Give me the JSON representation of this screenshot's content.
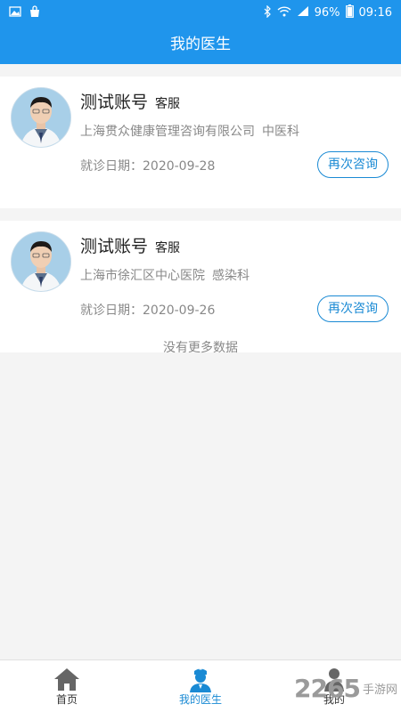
{
  "status_bar": {
    "battery": "96%",
    "time": "09:16",
    "icons": [
      "image-icon",
      "bag-icon",
      "bluetooth-icon",
      "wifi-icon",
      "signal-icon",
      "battery-icon"
    ]
  },
  "header": {
    "title": "我的医生"
  },
  "doctors": [
    {
      "name": "测试账号",
      "tag": "客服",
      "org": "上海贯众健康管理咨询有限公司",
      "dept": "中医科",
      "visit_date": "就诊日期：2020-09-28",
      "action_label": "再次咨询"
    },
    {
      "name": "测试账号",
      "tag": "客服",
      "org": "上海市徐汇区中心医院",
      "dept": "感染科",
      "visit_date": "就诊日期：2020-09-26",
      "action_label": "再次咨询"
    }
  ],
  "list_end_text": "没有更多数据",
  "tabbar": {
    "tabs": [
      {
        "label": "首页",
        "icon": "home-icon",
        "active": false
      },
      {
        "label": "我的医生",
        "icon": "doctor-icon",
        "active": true
      },
      {
        "label": "我的",
        "icon": "person-icon",
        "active": false
      }
    ]
  },
  "watermark": {
    "number": "2265",
    "text": "手游网"
  },
  "colors": {
    "brand": "#1f95ec",
    "accent": "#1a8ad4",
    "muted": "#888888"
  }
}
